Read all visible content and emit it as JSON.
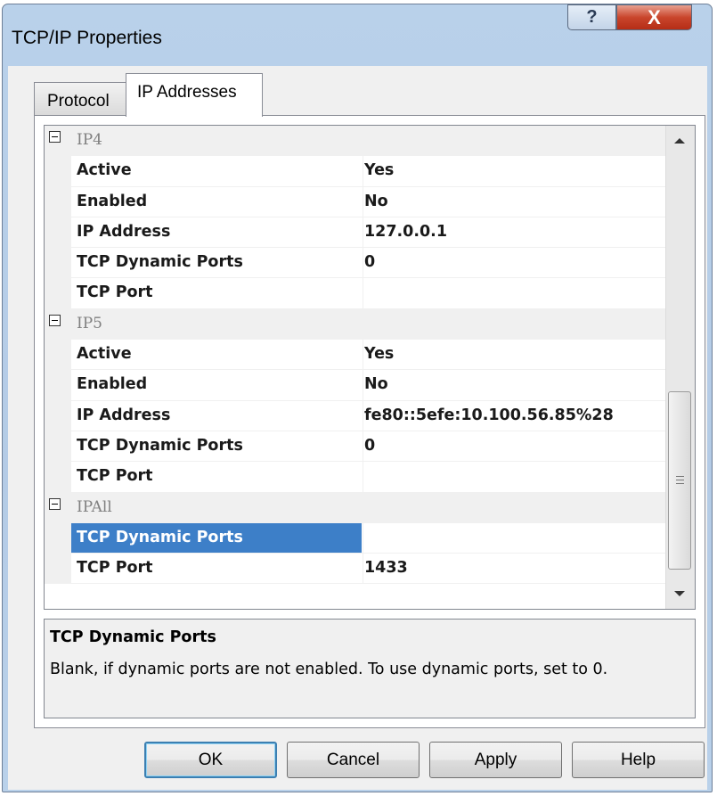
{
  "window": {
    "title": "TCP/IP Properties",
    "help_glyph": "?",
    "close_glyph": "X"
  },
  "tabs": [
    {
      "label": "Protocol",
      "selected": false
    },
    {
      "label": "IP Addresses",
      "selected": true
    }
  ],
  "grid": {
    "categories": [
      {
        "name": "IP4",
        "rows": [
          {
            "name": "Active",
            "value": "Yes"
          },
          {
            "name": "Enabled",
            "value": "No"
          },
          {
            "name": "IP Address",
            "value": "127.0.0.1"
          },
          {
            "name": "TCP Dynamic Ports",
            "value": "0"
          },
          {
            "name": "TCP Port",
            "value": ""
          }
        ]
      },
      {
        "name": "IP5",
        "rows": [
          {
            "name": "Active",
            "value": "Yes"
          },
          {
            "name": "Enabled",
            "value": "No"
          },
          {
            "name": "IP Address",
            "value": "fe80::5efe:10.100.56.85%28"
          },
          {
            "name": "TCP Dynamic Ports",
            "value": "0"
          },
          {
            "name": "TCP Port",
            "value": ""
          }
        ]
      },
      {
        "name": "IPAll",
        "rows": [
          {
            "name": "TCP Dynamic Ports",
            "value": "",
            "selected": true
          },
          {
            "name": "TCP Port",
            "value": "1433"
          }
        ]
      }
    ]
  },
  "description": {
    "title": "TCP Dynamic Ports",
    "text": "Blank, if dynamic ports are not enabled. To use dynamic ports, set to 0."
  },
  "buttons": {
    "ok": "OK",
    "cancel": "Cancel",
    "apply": "Apply",
    "help": "Help"
  },
  "colors": {
    "selection": "#3d7fc8",
    "close_button": "#c9452c"
  }
}
